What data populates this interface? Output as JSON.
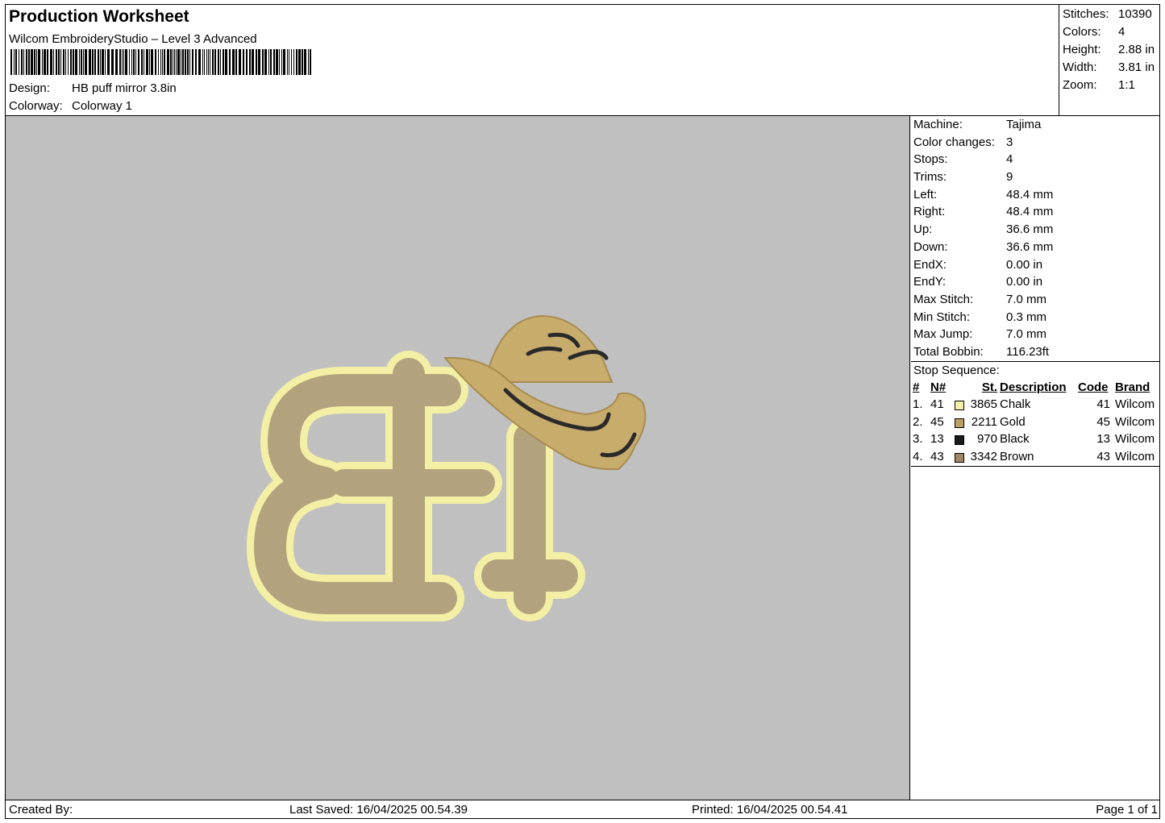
{
  "header": {
    "title": "Production Worksheet",
    "software": "Wilcom EmbroideryStudio – Level 3 Advanced",
    "design_label": "Design:",
    "design_value": "HB puff mirror 3.8in",
    "colorway_label": "Colorway:",
    "colorway_value": "Colorway 1"
  },
  "summary": {
    "stitches_label": "Stitches:",
    "stitches": "10390",
    "colors_label": "Colors:",
    "colors": "4",
    "height_label": "Height:",
    "height": "2.88 in",
    "width_label": "Width:",
    "width": "3.81 in",
    "zoom_label": "Zoom:",
    "zoom": "1:1"
  },
  "machine_info": [
    {
      "label": "Machine:",
      "value": "Tajima"
    },
    {
      "label": "Color changes:",
      "value": "3"
    },
    {
      "label": "Stops:",
      "value": "4"
    },
    {
      "label": "Trims:",
      "value": "9"
    },
    {
      "label": "Left:",
      "value": "48.4 mm"
    },
    {
      "label": "Right:",
      "value": "48.4 mm"
    },
    {
      "label": "Up:",
      "value": "36.6 mm"
    },
    {
      "label": "Down:",
      "value": "36.6 mm"
    },
    {
      "label": "EndX:",
      "value": "0.00 in"
    },
    {
      "label": "EndY:",
      "value": "0.00 in"
    },
    {
      "label": "Max Stitch:",
      "value": "7.0 mm"
    },
    {
      "label": "Min Stitch:",
      "value": "0.3 mm"
    },
    {
      "label": "Max Jump:",
      "value": "7.0 mm"
    },
    {
      "label": "Total Bobbin:",
      "value": "116.23ft"
    }
  ],
  "stop_sequence": {
    "title": "Stop Sequence:",
    "columns": [
      "#",
      "N#",
      "St.",
      "Description",
      "Code",
      "Brand"
    ],
    "rows": [
      {
        "num": "1.",
        "n": "41",
        "color": "#f5f0a8",
        "st": "3865",
        "desc": "Chalk",
        "code": "41",
        "brand": "Wilcom"
      },
      {
        "num": "2.",
        "n": "45",
        "color": "#c0a060",
        "st": "2211",
        "desc": "Gold",
        "code": "45",
        "brand": "Wilcom"
      },
      {
        "num": "3.",
        "n": "13",
        "color": "#1a1a1a",
        "st": "970",
        "desc": "Black",
        "code": "13",
        "brand": "Wilcom"
      },
      {
        "num": "4.",
        "n": "43",
        "color": "#a08866",
        "st": "3342",
        "desc": "Brown",
        "code": "43",
        "brand": "Wilcom"
      }
    ]
  },
  "colors": {
    "canvas_bg": "#c0c0c0",
    "chalk": "#f3efa4",
    "gold": "#c8ac6c",
    "brown": "#b3a27e",
    "black": "#2a2a2a"
  },
  "footer": {
    "created_by": "Created By:",
    "last_saved": "Last Saved: 16/04/2025 00.54.39",
    "printed": "Printed: 16/04/2025 00.54.41",
    "page": "Page 1 of 1"
  }
}
